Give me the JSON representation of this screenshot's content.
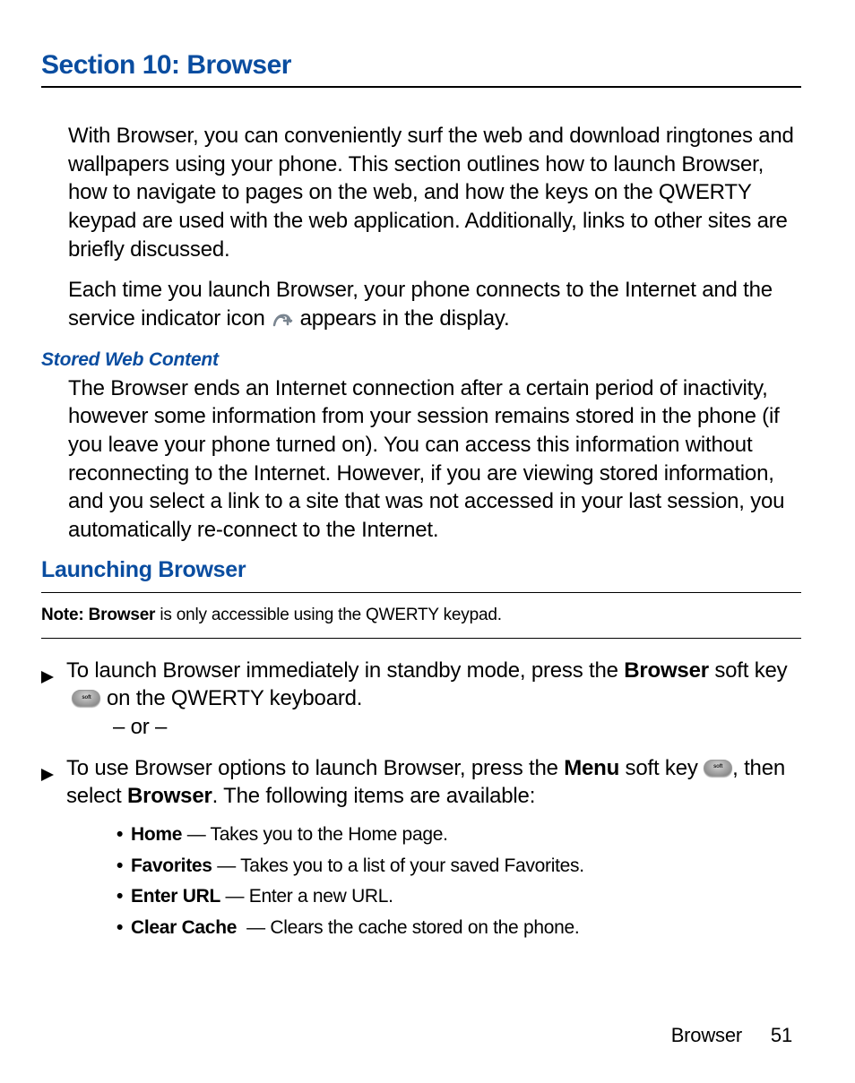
{
  "section_title": "Section 10: Browser",
  "intro_p1": "With Browser, you can conveniently surf the web and download ringtones and wallpapers using your phone.  This section outlines how to launch Browser, how to navigate to pages on the web, and how the keys on the QWERTY keypad are used with the web application. Additionally, links to other sites are briefly discussed.",
  "intro_p2a": "Each time you launch Browser, your phone connects to the Internet and the service indicator icon ",
  "intro_p2b": " appears in the display.",
  "stored_heading": "Stored Web Content",
  "stored_p": "The Browser ends an Internet connection after a certain period of inactivity, however some information from your session remains stored in the phone (if you leave your phone turned on). You can access this information without reconnecting to the Internet. However, if you are viewing stored information, and you select a link to a site that was not accessed in your last session, you automatically re-connect to the Internet.",
  "launch_heading": "Launching Browser",
  "note_prefix": "Note: Browser",
  "note_suffix": " is only accessible using the QWERTY keypad.",
  "step1_a": "To launch Browser immediately in standby mode, press the ",
  "step1_bold": "Browser",
  "step1_b": " soft key ",
  "step1_c": " on the QWERTY keyboard.",
  "or_text": "– or –",
  "step2_a": "To use Browser options to launch Browser, press the ",
  "step2_bold1": "Menu",
  "step2_b": " soft key ",
  "step2_c": ", then select ",
  "step2_bold2": "Browser",
  "step2_d": ".   The following items are available:",
  "items": [
    {
      "label": "Home",
      "desc": "Takes you to the Home page."
    },
    {
      "label": "Favorites",
      "desc": "Takes you to a list of your saved Favorites."
    },
    {
      "label": "Enter URL",
      "desc": "Enter a new URL."
    },
    {
      "label": "Clear Cache ",
      "desc": "Clears the cache stored on the phone."
    }
  ],
  "footer_label": "Browser",
  "footer_page": "51"
}
